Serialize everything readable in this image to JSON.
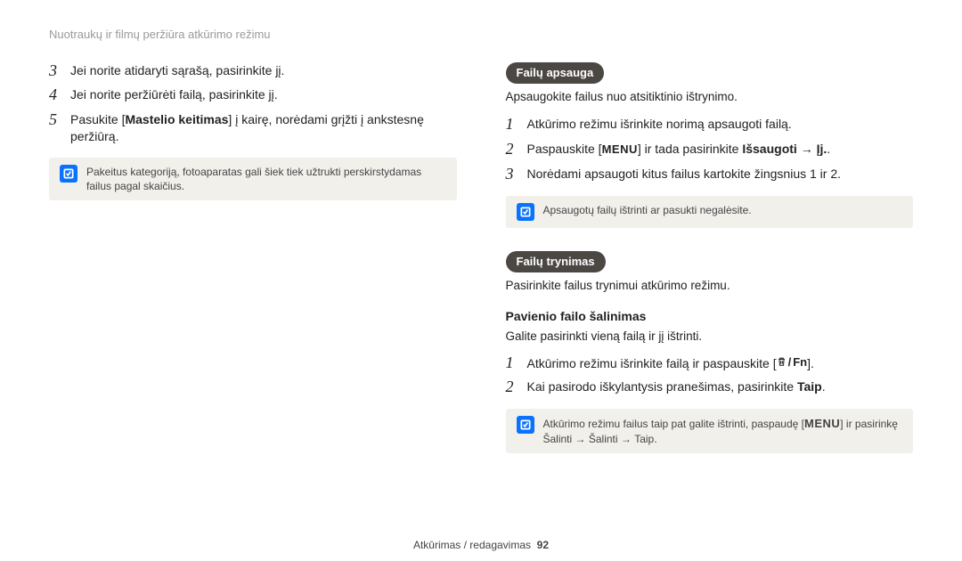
{
  "running_head": "Nuotraukų ir filmų peržiūra atkūrimo režimu",
  "left": {
    "steps": [
      {
        "n": "3",
        "text": "Jei norite atidaryti sąrašą, pasirinkite jį."
      },
      {
        "n": "4",
        "text": "Jei norite peržiūrėti failą, pasirinkite jį."
      },
      {
        "n": "5",
        "pre": "Pasukite [",
        "bold": "Mastelio keitimas",
        "post": "] į kairę, norėdami grįžti į ankstesnę peržiūrą."
      }
    ],
    "note": "Pakeitus kategoriją, fotoaparatas gali šiek tiek užtrukti perskirstydamas failus pagal skaičius."
  },
  "right": {
    "sec1": {
      "title": "Failų apsauga",
      "desc": "Apsaugokite failus nuo atsitiktinio ištrynimo.",
      "steps": [
        {
          "n": "1",
          "text": "Atkūrimo režimu išrinkite norimą apsaugoti failą."
        },
        {
          "n": "2",
          "pre": "Paspauskite [",
          "menu": "MENU",
          "mid": "] ir tada pasirinkite ",
          "bold": "Išsaugoti",
          "arrow": " → ",
          "bold2": "Įj.",
          "post": "."
        },
        {
          "n": "3",
          "text": "Norėdami apsaugoti kitus failus kartokite žingsnius 1 ir 2."
        }
      ],
      "note": "Apsaugotų failų ištrinti ar pasukti negalėsite."
    },
    "sec2": {
      "title": "Failų trynimas",
      "desc": "Pasirinkite failus trynimui atkūrimo režimu.",
      "sub_title": "Pavienio failo šalinimas",
      "sub_desc": "Galite pasirinkti vieną failą ir jį ištrinti.",
      "steps": [
        {
          "n": "1",
          "pre": "Atkūrimo režimu išrinkite failą ir paspauskite [",
          "fn": "Fn",
          "post": "]."
        },
        {
          "n": "2",
          "pre": "Kai pasirodo iškylantysis pranešimas, pasirinkite ",
          "bold": "Taip",
          "post": "."
        }
      ],
      "note_pre": "Atkūrimo režimu failus taip pat galite ištrinti, paspaudę [",
      "note_menu": "MENU",
      "note_mid": "] ir pasirinkę ",
      "note_b1": "Šalinti",
      "note_arrow1": " → ",
      "note_b2": "Šalinti",
      "note_arrow2": " → ",
      "note_b3": "Taip",
      "note_post": "."
    }
  },
  "footer": {
    "chapter": "Atkūrimas / redagavimas",
    "page": "92"
  },
  "icons": {
    "note": "note-icon",
    "trash": "trash-icon",
    "menu": "menu-label"
  }
}
